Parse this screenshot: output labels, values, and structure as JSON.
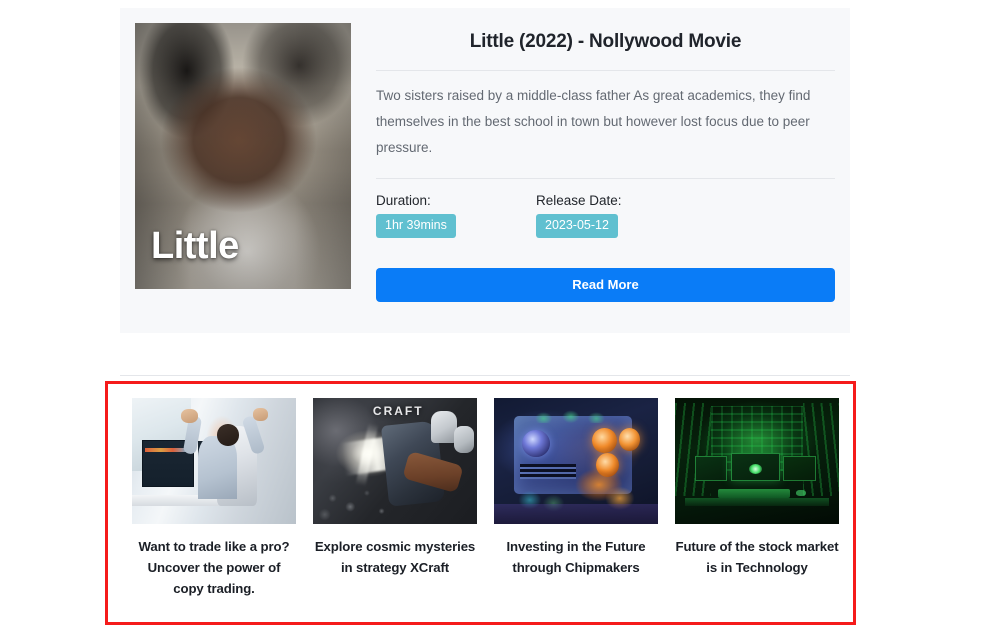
{
  "movie": {
    "poster_label": "Little",
    "title": "Little (2022) - Nollywood Movie",
    "description": "Two sisters raised by a middle-class father As great academics, they find themselves in the best school in town but however lost focus due to peer pressure.",
    "duration_label": "Duration:",
    "duration_value": "1hr 39mins",
    "release_label": "Release Date:",
    "release_value": "2023-05-12",
    "read_more_label": "Read More",
    "badge_color": "#60c0d0",
    "button_color": "#0a7cf7"
  },
  "articles": {
    "highlight_color": "#f51b1b",
    "items": [
      {
        "title": "Want to trade like a pro? Uncover the power of copy trading.",
        "thumb": "trading-desk-image"
      },
      {
        "title": "Explore cosmic mysteries in strategy XCraft",
        "thumb": "xcraft-space-image",
        "overlay_logo": "CRAFT"
      },
      {
        "title": "Investing in the Future through Chipmakers",
        "thumb": "chipmaker-pc-image"
      },
      {
        "title": "Future of the stock market is in Technology",
        "thumb": "green-server-room-image"
      }
    ]
  }
}
